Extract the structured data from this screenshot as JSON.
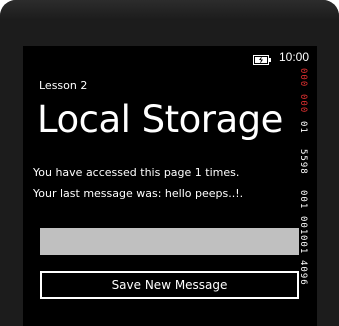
{
  "status_bar": {
    "time": "10:00",
    "battery_icon": "battery-charging-icon"
  },
  "app": {
    "title": "Lesson 2",
    "page_title": "Local Storage"
  },
  "content": {
    "access_text": "You have accessed this page 1 times.",
    "last_message_text": "Your last message was: hello peeps..!."
  },
  "message_input": {
    "value": "",
    "placeholder": ""
  },
  "save_button": {
    "label": "Save New Message"
  },
  "frame_counters": [
    {
      "text": "000",
      "color": "#e03030"
    },
    {
      "text": "000",
      "color": "#e03030"
    },
    {
      "text": "01",
      "color": "#ffffff"
    },
    {
      "text": "5598",
      "color": "#ffffff"
    },
    {
      "text": "001",
      "color": "#ffffff"
    },
    {
      "text": "001",
      "color": "#ffffff"
    },
    {
      "text": "001",
      "color": "#ffffff"
    },
    {
      "text": "4096",
      "color": "#ffffff"
    }
  ]
}
